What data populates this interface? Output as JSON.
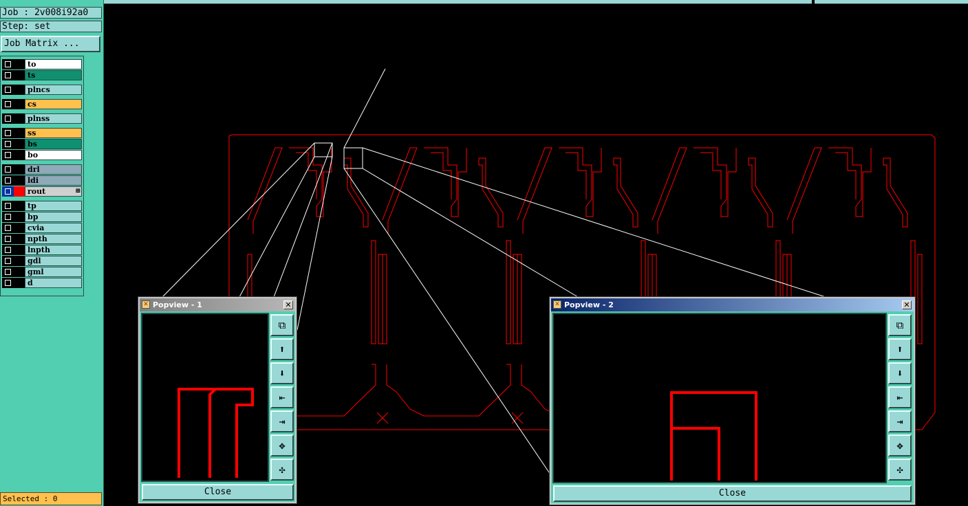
{
  "info": {
    "job": "Job : 2v008i92a0",
    "step": "Step: set",
    "job_matrix_button": "Job Matrix ..."
  },
  "layers": [
    {
      "name": "to",
      "bg": "#ffffff",
      "color": "#000000",
      "group": 0
    },
    {
      "name": "ts",
      "bg": "#0f9070",
      "color": "#000000",
      "group": 0
    },
    {
      "name": "plncs",
      "bg": "#9ad8d6",
      "color": "#000000",
      "group": 1
    },
    {
      "name": "cs",
      "bg": "#ffc04d",
      "color": "#000000",
      "group": 2
    },
    {
      "name": "plnss",
      "bg": "#9ad8d6",
      "color": "#000000",
      "group": 3
    },
    {
      "name": "ss",
      "bg": "#ffc04d",
      "color": "#000000",
      "group": 4
    },
    {
      "name": "bs",
      "bg": "#0f9070",
      "color": "#000000",
      "group": 4
    },
    {
      "name": "bo",
      "bg": "#ffffff",
      "color": "#000000",
      "group": 4
    },
    {
      "name": "drl",
      "bg": "#8faab8",
      "color": "#000000",
      "group": 5
    },
    {
      "name": "ldi",
      "bg": "#8faab8",
      "color": "#000000",
      "group": 5
    },
    {
      "name": "rout",
      "bg": "#d0d0d0",
      "color": "#ff0000",
      "group": 5,
      "active": true
    },
    {
      "name": "tp",
      "bg": "#9ad8d6",
      "color": "#000000",
      "group": 6
    },
    {
      "name": "bp",
      "bg": "#9ad8d6",
      "color": "#000000",
      "group": 6
    },
    {
      "name": "cvia",
      "bg": "#9ad8d6",
      "color": "#000000",
      "group": 6
    },
    {
      "name": "npth",
      "bg": "#9ad8d6",
      "color": "#000000",
      "group": 6
    },
    {
      "name": "lnpth",
      "bg": "#9ad8d6",
      "color": "#000000",
      "group": 6
    },
    {
      "name": "gdl",
      "bg": "#9ad8d6",
      "color": "#000000",
      "group": 6
    },
    {
      "name": "gml",
      "bg": "#9ad8d6",
      "color": "#000000",
      "group": 6
    },
    {
      "name": "d",
      "bg": "#9ad8d6",
      "color": "#000000",
      "group": 6
    }
  ],
  "selected": "Selected : 0",
  "canvas": {
    "background": "#000000",
    "outline_color": "#ff0000"
  },
  "popviews": [
    {
      "title": "Popview - 1",
      "close_label": "Close",
      "title_bg": [
        "#808080",
        "#b8b8b8"
      ],
      "tools": [
        "zoom-window-icon",
        "pan-up-icon",
        "pan-down-icon",
        "pan-left-icon",
        "pan-right-icon",
        "zoom-out-icon",
        "zoom-in-icon"
      ]
    },
    {
      "title": "Popview - 2",
      "close_label": "Close",
      "title_bg": [
        "#0a246a",
        "#a6caf0"
      ],
      "tools": [
        "zoom-window-icon",
        "pan-up-icon",
        "pan-down-icon",
        "pan-left-icon",
        "pan-right-icon",
        "zoom-out-icon",
        "zoom-in-icon"
      ]
    }
  ]
}
